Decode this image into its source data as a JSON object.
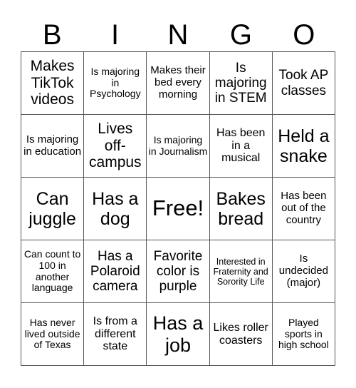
{
  "header": {
    "letters": [
      "B",
      "I",
      "N",
      "G",
      "O"
    ]
  },
  "cells": [
    "Makes TikTok videos",
    "Is majoring in Psychology",
    "Makes their bed every morning",
    "Is majoring in STEM",
    "Took AP classes",
    "Is majoring in education",
    "Lives off-campus",
    "Is majoring in Journalism",
    "Has been in a musical",
    "Held a snake",
    "Can juggle",
    "Has a dog",
    "Free!",
    "Bakes bread",
    "Has been out of the country",
    "Can count to 100 in another language",
    "Has a Polaroid camera",
    "Favorite color is purple",
    "Interested in Fraternity and Sorority Life",
    "Is undecided (major)",
    "Has never lived outside of Texas",
    "Is from a different state",
    "Has a job",
    "Likes roller coasters",
    "Played sports in high school"
  ]
}
